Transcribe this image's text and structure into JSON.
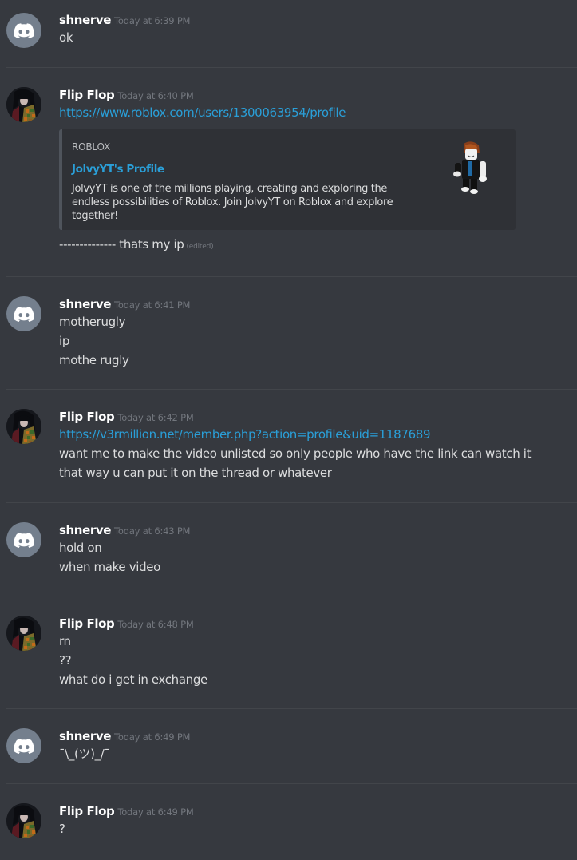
{
  "users": {
    "shnerve": {
      "name": "shnerve",
      "avatar_icon": "discord-logo-icon",
      "avatar_color": "#747f8d"
    },
    "flipflop": {
      "name": "Flip Flop",
      "avatar_icon": "anime-character-avatar"
    }
  },
  "colors": {
    "background": "#36393f",
    "link": "#2a9fd8",
    "username": "#ffffff",
    "timestamp": "#72767d",
    "embed_bg": "#2f3136",
    "embed_border": "#4f545c"
  },
  "messages": [
    {
      "author": "shnerve",
      "timestamp": "Today at 6:39 PM",
      "lines": [
        "ok"
      ]
    },
    {
      "author": "Flip Flop",
      "timestamp": "Today at 6:40 PM",
      "link": "https://www.roblox.com/users/1300063954/profile",
      "embed": {
        "provider": "ROBLOX",
        "title": "JolvyYT's Profile",
        "description": "JolvyYT is one of the millions playing, creating and exploring the endless possibilities of Roblox. Join JolvyYT on Roblox and explore together!",
        "thumbnail_icon": "roblox-avatar-thumbnail"
      },
      "after_embed_text": "-------------- thats my ip",
      "edited_label": "(edited)"
    },
    {
      "author": "shnerve",
      "timestamp": "Today at 6:41 PM",
      "lines": [
        "motherugly",
        "ip",
        "mothe rugly"
      ]
    },
    {
      "author": "Flip Flop",
      "timestamp": "Today at 6:42 PM",
      "link": "https://v3rmillion.net/member.php?action=profile&uid=1187689",
      "lines": [
        "want me to make the video unlisted so only people who have the link can watch it",
        "that way u can put it on the thread or whatever"
      ]
    },
    {
      "author": "shnerve",
      "timestamp": "Today at 6:43 PM",
      "lines": [
        "hold on",
        "when make video"
      ]
    },
    {
      "author": "Flip Flop",
      "timestamp": "Today at 6:48 PM",
      "lines": [
        "rn",
        "??",
        "what do i get in exchange"
      ]
    },
    {
      "author": "shnerve",
      "timestamp": "Today at 6:49 PM",
      "lines": [
        "¯\\_(ツ)_/¯"
      ]
    },
    {
      "author": "Flip Flop",
      "timestamp": "Today at 6:49 PM",
      "lines": [
        "?"
      ]
    }
  ]
}
